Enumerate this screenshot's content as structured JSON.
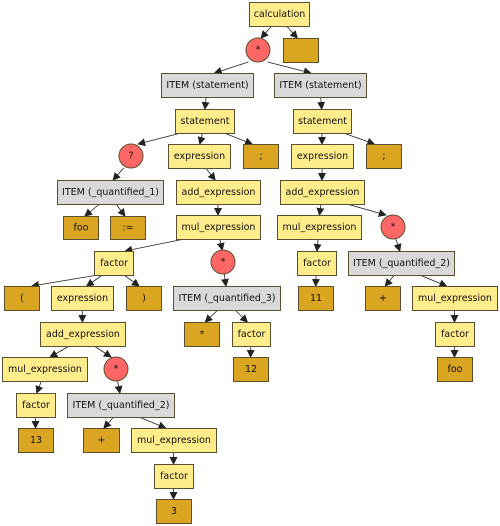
{
  "colors": {
    "rule": "#ffec8b",
    "token": "#daa520",
    "item": "#d9d9d9",
    "quantifier": "#ff6666",
    "border": "#5a5030",
    "edge": "#222222"
  },
  "nodes": [
    {
      "id": "n1",
      "label": "calculation",
      "kind": "rule"
    },
    {
      "id": "n2",
      "label": "*",
      "kind": "quantifier"
    },
    {
      "id": "n3",
      "label": "",
      "kind": "token"
    },
    {
      "id": "n4",
      "label": "ITEM (statement)",
      "kind": "item"
    },
    {
      "id": "n5",
      "label": "ITEM (statement)",
      "kind": "item"
    },
    {
      "id": "n6",
      "label": "statement",
      "kind": "rule"
    },
    {
      "id": "n7",
      "label": "?",
      "kind": "quantifier"
    },
    {
      "id": "n8",
      "label": "expression",
      "kind": "rule"
    },
    {
      "id": "n9",
      "label": ";",
      "kind": "token"
    },
    {
      "id": "n10",
      "label": "statement",
      "kind": "rule"
    },
    {
      "id": "n11",
      "label": "expression",
      "kind": "rule"
    },
    {
      "id": "n12",
      "label": ";",
      "kind": "token"
    },
    {
      "id": "n13",
      "label": "ITEM (_quantified_1)",
      "kind": "item"
    },
    {
      "id": "n14",
      "label": "foo",
      "kind": "token"
    },
    {
      "id": "n15",
      "label": ":=",
      "kind": "token"
    },
    {
      "id": "n16",
      "label": "add_expression",
      "kind": "rule"
    },
    {
      "id": "n17",
      "label": "mul_expression",
      "kind": "rule"
    },
    {
      "id": "n18",
      "label": "add_expression",
      "kind": "rule"
    },
    {
      "id": "n19",
      "label": "mul_expression",
      "kind": "rule"
    },
    {
      "id": "n20",
      "label": "*",
      "kind": "quantifier"
    },
    {
      "id": "n21",
      "label": "factor",
      "kind": "rule"
    },
    {
      "id": "n22",
      "label": "*",
      "kind": "quantifier"
    },
    {
      "id": "n23",
      "label": "factor",
      "kind": "rule"
    },
    {
      "id": "n24",
      "label": "ITEM (_quantified_2)",
      "kind": "item"
    },
    {
      "id": "n25",
      "label": "(",
      "kind": "token"
    },
    {
      "id": "n26",
      "label": "expression",
      "kind": "rule"
    },
    {
      "id": "n27",
      "label": ")",
      "kind": "token"
    },
    {
      "id": "n28",
      "label": "ITEM (_quantified_3)",
      "kind": "item"
    },
    {
      "id": "n29",
      "label": "11",
      "kind": "token"
    },
    {
      "id": "n30",
      "label": "+",
      "kind": "token"
    },
    {
      "id": "n31",
      "label": "mul_expression",
      "kind": "rule"
    },
    {
      "id": "n32",
      "label": "add_expression",
      "kind": "rule"
    },
    {
      "id": "n33",
      "label": "*",
      "kind": "token"
    },
    {
      "id": "n34",
      "label": "factor",
      "kind": "rule"
    },
    {
      "id": "n35",
      "label": "factor",
      "kind": "rule"
    },
    {
      "id": "n36",
      "label": "mul_expression",
      "kind": "rule"
    },
    {
      "id": "n37",
      "label": "*",
      "kind": "quantifier"
    },
    {
      "id": "n38",
      "label": "12",
      "kind": "token"
    },
    {
      "id": "n39",
      "label": "foo",
      "kind": "token"
    },
    {
      "id": "n40",
      "label": "factor",
      "kind": "rule"
    },
    {
      "id": "n41",
      "label": "ITEM (_quantified_2)",
      "kind": "item"
    },
    {
      "id": "n42",
      "label": "13",
      "kind": "token"
    },
    {
      "id": "n43",
      "label": "+",
      "kind": "token"
    },
    {
      "id": "n44",
      "label": "mul_expression",
      "kind": "rule"
    },
    {
      "id": "n45",
      "label": "factor",
      "kind": "rule"
    },
    {
      "id": "n46",
      "label": "3",
      "kind": "token"
    }
  ],
  "edges": [
    [
      "n1",
      "n2"
    ],
    [
      "n1",
      "n3"
    ],
    [
      "n2",
      "n4"
    ],
    [
      "n2",
      "n5"
    ],
    [
      "n4",
      "n6"
    ],
    [
      "n5",
      "n10"
    ],
    [
      "n6",
      "n7"
    ],
    [
      "n6",
      "n8"
    ],
    [
      "n6",
      "n9"
    ],
    [
      "n10",
      "n11"
    ],
    [
      "n10",
      "n12"
    ],
    [
      "n7",
      "n13"
    ],
    [
      "n13",
      "n14"
    ],
    [
      "n13",
      "n15"
    ],
    [
      "n8",
      "n16"
    ],
    [
      "n16",
      "n17"
    ],
    [
      "n11",
      "n18"
    ],
    [
      "n18",
      "n19"
    ],
    [
      "n18",
      "n20"
    ],
    [
      "n17",
      "n21"
    ],
    [
      "n17",
      "n22"
    ],
    [
      "n19",
      "n23"
    ],
    [
      "n20",
      "n24"
    ],
    [
      "n21",
      "n25"
    ],
    [
      "n21",
      "n26"
    ],
    [
      "n21",
      "n27"
    ],
    [
      "n22",
      "n28"
    ],
    [
      "n23",
      "n29"
    ],
    [
      "n24",
      "n30"
    ],
    [
      "n24",
      "n31"
    ],
    [
      "n26",
      "n32"
    ],
    [
      "n28",
      "n33"
    ],
    [
      "n28",
      "n34"
    ],
    [
      "n31",
      "n35"
    ],
    [
      "n32",
      "n36"
    ],
    [
      "n32",
      "n37"
    ],
    [
      "n34",
      "n38"
    ],
    [
      "n35",
      "n39"
    ],
    [
      "n36",
      "n40"
    ],
    [
      "n37",
      "n41"
    ],
    [
      "n40",
      "n42"
    ],
    [
      "n41",
      "n43"
    ],
    [
      "n41",
      "n44"
    ],
    [
      "n44",
      "n45"
    ],
    [
      "n45",
      "n46"
    ]
  ]
}
